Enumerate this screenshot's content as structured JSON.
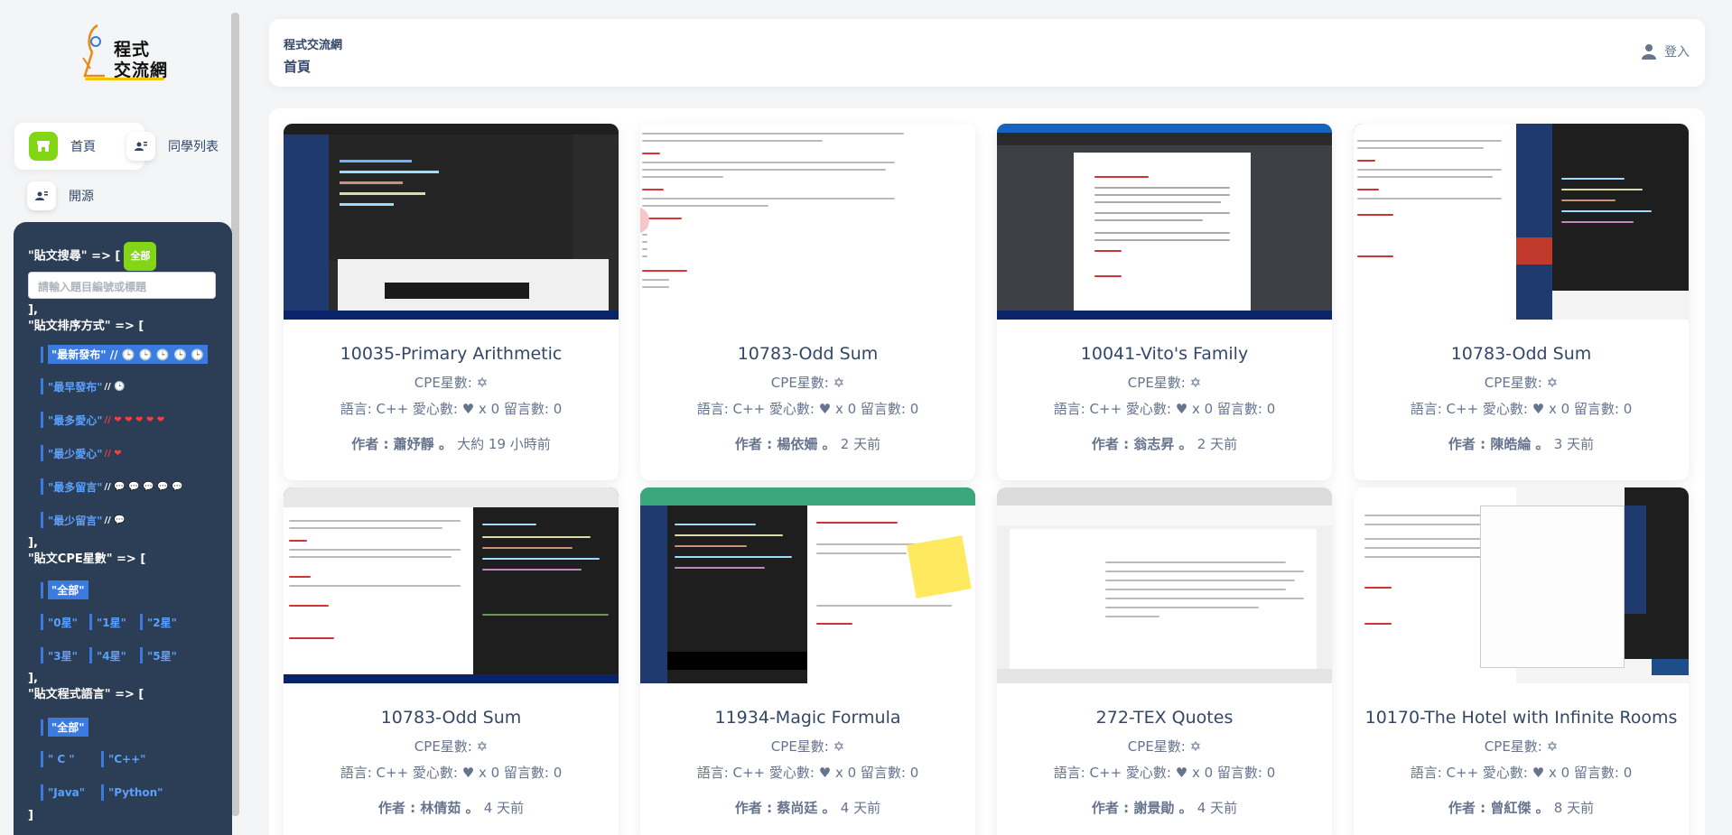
{
  "logo": {
    "line1": "程式",
    "line2": "交流網"
  },
  "nav": [
    {
      "label": "首頁",
      "icon": "shop-icon",
      "active": true
    },
    {
      "label": "同學列表",
      "icon": "users-icon",
      "active": false
    },
    {
      "label": "開源",
      "icon": "code-icon",
      "active": false
    }
  ],
  "filters": {
    "search_title": "\"貼文搜尋\" => [",
    "all_chip": "全部",
    "search_placeholder": "請輸入題目編號或標題",
    "close1": "],",
    "sort_title": "\"貼文排序方式\" => [",
    "sort_options": [
      {
        "label": "\"最新發布\"",
        "suffix": "// 🕒 🕒 🕒 🕒 🕒",
        "selected": true
      },
      {
        "label": "\"最早發布\"",
        "suffix": "// 🕒",
        "selected": false
      },
      {
        "label": "\"最多愛心\"",
        "suffix": "// ❤ ❤ ❤ ❤ ❤",
        "selected": false
      },
      {
        "label": "\"最少愛心\"",
        "suffix": "// ❤",
        "selected": false
      },
      {
        "label": "\"最多留言\"",
        "suffix": "// 💬 💬 💬 💬 💬",
        "selected": false
      },
      {
        "label": "\"最少留言\"",
        "suffix": "// 💬",
        "selected": false
      }
    ],
    "close2": "],",
    "cpe_title": "\"貼文CPE星數\" => [",
    "cpe_all": "\"全部\"",
    "cpe_options": [
      "\"0星\"",
      "\"1星\"",
      "\"2星\"",
      "\"3星\"",
      "\"4星\"",
      "\"5星\""
    ],
    "close3": "],",
    "lang_title": "\"貼文程式語言\" => [",
    "lang_all": "\"全部\"",
    "lang_options": [
      "\" C \"",
      "\"C++\"",
      "\"Java\"",
      "\"Python\""
    ],
    "close4": "]"
  },
  "topbar": {
    "parent": "程式交流網",
    "current": "首頁",
    "login": "登入"
  },
  "cards": [
    {
      "title": "10035-Primary Arithmetic",
      "cpe": "CPE星數: ✡",
      "meta": "語言: C++  愛心數: ♥ x 0  留言數: 0",
      "author": "作者 : 蕭妤靜 。",
      "time": "大約 19 小時前"
    },
    {
      "title": "10783-Odd Sum",
      "cpe": "CPE星數: ✡",
      "meta": "語言: C++  愛心數: ♥ x 0  留言數: 0",
      "author": "作者 : 楊依姍 。",
      "time": "2 天前"
    },
    {
      "title": "10041-Vito's Family",
      "cpe": "CPE星數: ✡",
      "meta": "語言: C++  愛心數: ♥ x 0  留言數: 0",
      "author": "作者 : 翁志昇 。",
      "time": "2 天前"
    },
    {
      "title": "10783-Odd Sum",
      "cpe": "CPE星數: ✡",
      "meta": "語言: C++  愛心數: ♥ x 0  留言數: 0",
      "author": "作者 : 陳皓綸 。",
      "time": "3 天前"
    },
    {
      "title": "10783-Odd Sum",
      "cpe": "CPE星數: ✡",
      "meta": "語言: C++  愛心數: ♥ x 0  留言數: 0",
      "author": "作者 : 林倩茹 。",
      "time": "4 天前"
    },
    {
      "title": "11934-Magic Formula",
      "cpe": "CPE星數: ✡",
      "meta": "語言: C++  愛心數: ♥ x 0  留言數: 0",
      "author": "作者 : 蔡尚廷 。",
      "time": "4 天前"
    },
    {
      "title": "272-TEX Quotes",
      "cpe": "CPE星數: ✡",
      "meta": "語言: C++  愛心數: ♥ x 0  留言數: 0",
      "author": "作者 : 謝景勛 。",
      "time": "4 天前"
    },
    {
      "title": "10170-The Hotel with Infinite Rooms",
      "cpe": "CPE星數: ✡",
      "meta": "語言: C++  愛心數: ♥ x 0  留言數: 0",
      "author": "作者 : 曾紅傑 。",
      "time": "8 天前"
    }
  ]
}
